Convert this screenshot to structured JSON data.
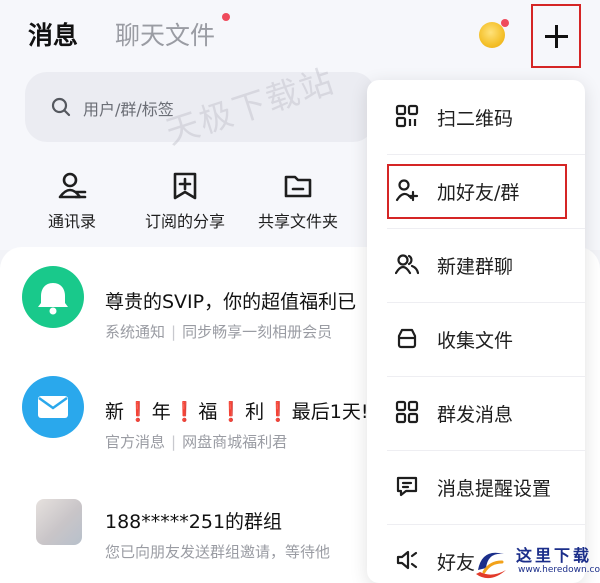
{
  "header": {
    "tab_messages": "消息",
    "tab_chat_files": "聊天文件"
  },
  "search": {
    "placeholder": "用户/群/标签"
  },
  "watermark": {
    "text": "天极下载站"
  },
  "quick_actions": [
    {
      "label": "通讯录",
      "icon": "contacts-icon"
    },
    {
      "label": "订阅的分享",
      "icon": "bookmark-plus-icon"
    },
    {
      "label": "共享文件夹",
      "icon": "shared-folder-icon"
    }
  ],
  "chats": [
    {
      "title": "尊贵的SVIP，你的超值福利已",
      "source": "系统通知",
      "preview": "同步畅享一刻相册会员",
      "icon": "bell-icon"
    },
    {
      "title_parts": [
        "新",
        "❗",
        "年",
        "❗",
        "福",
        "❗",
        "利",
        "❗",
        "最后1天!"
      ],
      "source": "官方消息",
      "preview": "网盘商城福利君",
      "icon": "mail-icon"
    },
    {
      "title": "188*****251的群组",
      "preview": "您已向朋友发送群组邀请，等待他",
      "icon": "group-avatar"
    }
  ],
  "menu": {
    "items": [
      {
        "label": "扫二维码",
        "icon": "scan-qr-icon"
      },
      {
        "label": "加好友/群",
        "icon": "add-friend-icon"
      },
      {
        "label": "新建群聊",
        "icon": "group-chat-icon"
      },
      {
        "label": "收集文件",
        "icon": "collect-files-icon"
      },
      {
        "label": "群发消息",
        "icon": "broadcast-icon"
      },
      {
        "label": "消息提醒设置",
        "icon": "message-settings-icon"
      },
      {
        "label": "好友",
        "icon": "speaker-icon"
      }
    ]
  },
  "logo": {
    "text": "这里下载",
    "url": "www.heredown.com"
  },
  "colors": {
    "accent_red": "#d52525",
    "badge_red": "#ef4b5c",
    "bell_green": "#19c98b",
    "mail_blue": "#2aa8ec"
  }
}
